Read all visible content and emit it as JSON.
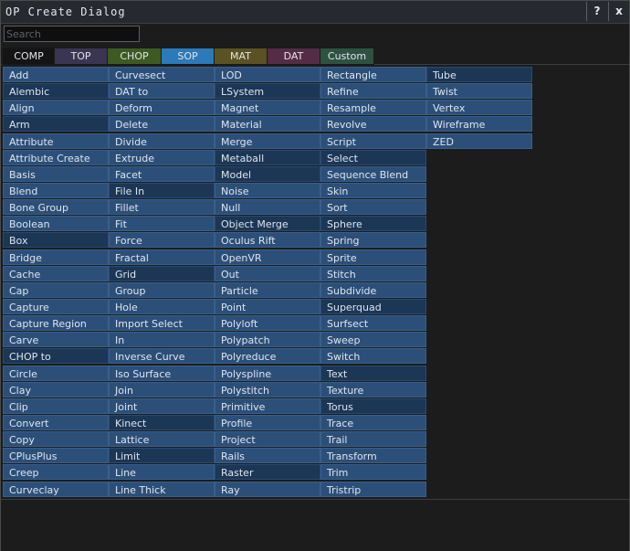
{
  "window": {
    "title": "OP Create Dialog",
    "help_label": "?",
    "close_label": "x"
  },
  "search": {
    "placeholder": "Search",
    "value": ""
  },
  "tabs": [
    {
      "label": "COMP",
      "color": "#141414",
      "active": false
    },
    {
      "label": "TOP",
      "color": "#3a3552",
      "active": false
    },
    {
      "label": "CHOP",
      "color": "#3e5a22",
      "active": false
    },
    {
      "label": "SOP",
      "color": "#2c7ab8",
      "active": true
    },
    {
      "label": "MAT",
      "color": "#5a5222",
      "active": false
    },
    {
      "label": "DAT",
      "color": "#552c45",
      "active": false
    },
    {
      "label": "Custom",
      "color": "#2e5242",
      "active": false
    }
  ],
  "columns": [
    [
      "Add",
      "Alembic",
      "Align",
      "Arm",
      "Attribute",
      "Attribute Create",
      "Basis",
      "Blend",
      "Bone Group",
      "Boolean",
      "Box",
      "Bridge",
      "Cache",
      "Cap",
      "Capture",
      "Capture Region",
      "Carve",
      "CHOP to",
      "Circle",
      "Clay",
      "Clip",
      "Convert",
      "Copy",
      "CPlusPlus",
      "Creep",
      "Curveclay"
    ],
    [
      "Curvesect",
      "DAT to",
      "Deform",
      "Delete",
      "Divide",
      "Extrude",
      "Facet",
      "File In",
      "Fillet",
      "Fit",
      "Force",
      "Fractal",
      "Grid",
      "Group",
      "Hole",
      "Import Select",
      "In",
      "Inverse Curve",
      "Iso Surface",
      "Join",
      "Joint",
      "Kinect",
      "Lattice",
      "Limit",
      "Line",
      "Line Thick"
    ],
    [
      "LOD",
      "LSystem",
      "Magnet",
      "Material",
      "Merge",
      "Metaball",
      "Model",
      "Noise",
      "Null",
      "Object Merge",
      "Oculus Rift",
      "OpenVR",
      "Out",
      "Particle",
      "Point",
      "Polyloft",
      "Polypatch",
      "Polyreduce",
      "Polyspline",
      "Polystitch",
      "Primitive",
      "Profile",
      "Project",
      "Rails",
      "Raster",
      "Ray"
    ],
    [
      "Rectangle",
      "Refine",
      "Resample",
      "Revolve",
      "Script",
      "Select",
      "Sequence Blend",
      "Skin",
      "Sort",
      "Sphere",
      "Spring",
      "Sprite",
      "Stitch",
      "Subdivide",
      "Superquad",
      "Surfsect",
      "Sweep",
      "Switch",
      "Text",
      "Texture",
      "Torus",
      "Trace",
      "Trail",
      "Transform",
      "Trim",
      "Tristrip"
    ],
    [
      "Tube",
      "Twist",
      "Vertex",
      "Wireframe",
      "ZED"
    ]
  ],
  "dark_cells": {
    "0": [
      1,
      3,
      10,
      17
    ],
    "1": [
      7,
      12,
      21,
      23
    ],
    "2": [
      1,
      5,
      6,
      9,
      24
    ],
    "3": [
      5,
      9,
      14,
      18,
      20
    ],
    "4": [
      0
    ]
  }
}
